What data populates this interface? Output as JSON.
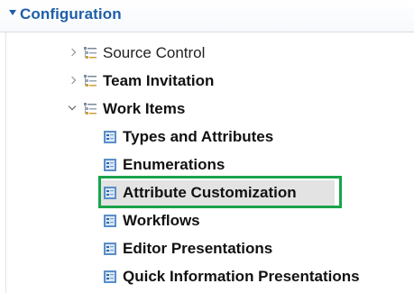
{
  "section": {
    "title": "Configuration"
  },
  "tree": {
    "source_control": "Source Control",
    "team_invitation": "Team Invitation",
    "work_items": "Work Items",
    "children": [
      "Types and Attributes",
      "Enumerations",
      "Attribute Customization",
      "Workflows",
      "Editor Presentations",
      "Quick Information Presentations"
    ],
    "selected_index": 2
  },
  "colors": {
    "section_title": "#1f5fa8",
    "highlight_border": "#1aa34a",
    "selection": "#e3e3e3"
  }
}
